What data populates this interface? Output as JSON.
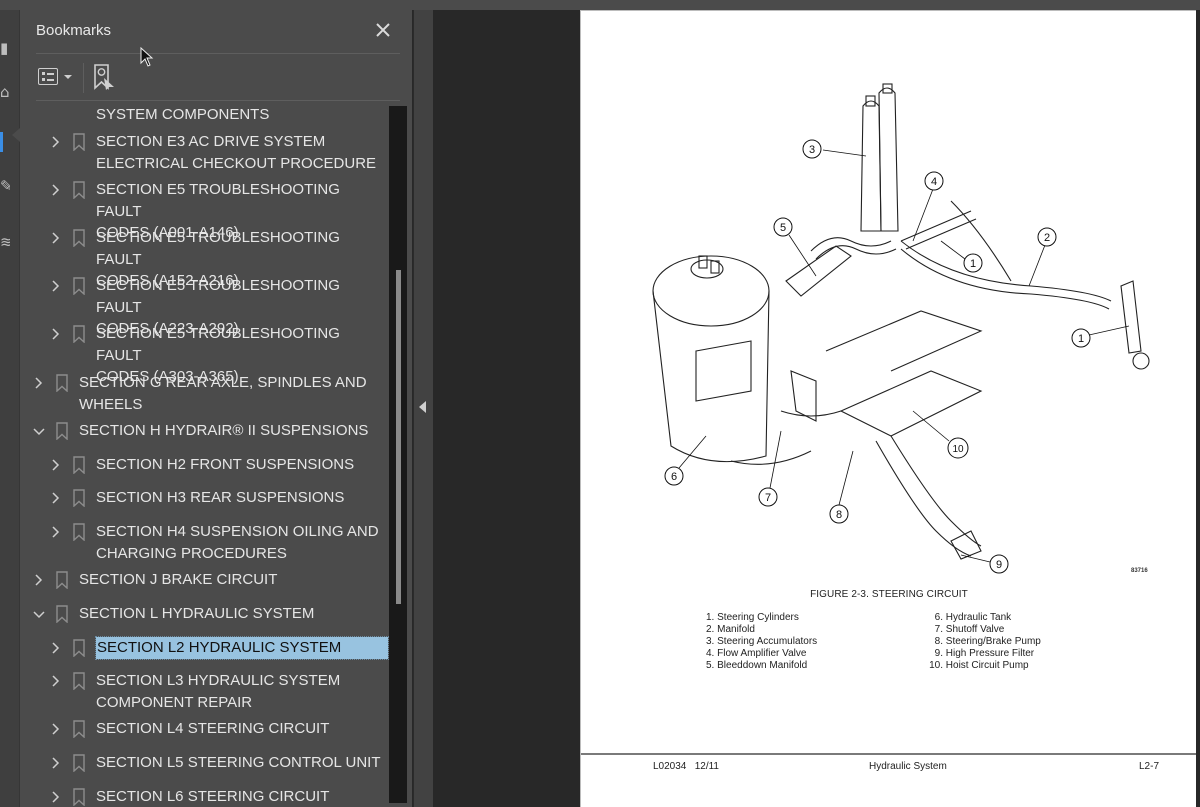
{
  "panel": {
    "title": "Bookmarks",
    "close_icon": "close-icon",
    "toolbar": {
      "options_icon": "list-options-icon",
      "new_bookmark_icon": "add-bookmark-icon"
    }
  },
  "bookmarks": [
    {
      "level": 2,
      "expanded": null,
      "partial": true,
      "label_lines": [
        "",
        "SYSTEM COMPONENTS"
      ]
    },
    {
      "level": 2,
      "expanded": false,
      "label_lines": [
        "SECTION E3 AC DRIVE SYSTEM",
        "ELECTRICAL CHECKOUT PROCEDURE"
      ]
    },
    {
      "level": 2,
      "expanded": false,
      "label_lines": [
        "SECTION E5 TROUBLESHOOTING FAULT",
        "CODES (A001-A146)"
      ]
    },
    {
      "level": 2,
      "expanded": false,
      "label_lines": [
        "SECTION E5 TROUBLESHOOTING FAULT",
        "CODES (A152-A216)"
      ]
    },
    {
      "level": 2,
      "expanded": false,
      "label_lines": [
        "SECTION E5 TROUBLESHOOTING FAULT",
        "CODES (A223-A292)"
      ]
    },
    {
      "level": 2,
      "expanded": false,
      "label_lines": [
        "SECTION E5 TROUBLESHOOTING FAULT",
        "CODES (A303-A365)"
      ]
    },
    {
      "level": 1,
      "expanded": false,
      "label_lines": [
        "SECTION G REAR AXLE, SPINDLES AND",
        "WHEELS"
      ]
    },
    {
      "level": 1,
      "expanded": true,
      "label_lines": [
        "SECTION H HYDRAIR® II SUSPENSIONS"
      ]
    },
    {
      "level": 2,
      "expanded": false,
      "label_lines": [
        "SECTION H2 FRONT SUSPENSIONS"
      ]
    },
    {
      "level": 2,
      "expanded": false,
      "label_lines": [
        "SECTION H3 REAR SUSPENSIONS"
      ]
    },
    {
      "level": 2,
      "expanded": false,
      "label_lines": [
        "SECTION H4 SUSPENSION OILING AND",
        "CHARGING PROCEDURES"
      ]
    },
    {
      "level": 1,
      "expanded": false,
      "label_lines": [
        "SECTION J BRAKE CIRCUIT"
      ]
    },
    {
      "level": 1,
      "expanded": true,
      "label_lines": [
        "SECTION L HYDRAULIC SYSTEM"
      ]
    },
    {
      "level": 2,
      "expanded": false,
      "selected": true,
      "label_lines": [
        "SECTION L2 HYDRAULIC SYSTEM"
      ]
    },
    {
      "level": 2,
      "expanded": false,
      "label_lines": [
        "SECTION L3 HYDRAULIC SYSTEM",
        "COMPONENT REPAIR"
      ]
    },
    {
      "level": 2,
      "expanded": false,
      "label_lines": [
        "SECTION L4 STEERING CIRCUIT"
      ]
    },
    {
      "level": 2,
      "expanded": false,
      "label_lines": [
        "SECTION L5 STEERING CONTROL UNIT"
      ]
    },
    {
      "level": 2,
      "expanded": false,
      "label_lines": [
        "SECTION L6 STEERING CIRCUIT"
      ]
    }
  ],
  "document": {
    "figure": {
      "caption": "FIGURE 2-3. STEERING CIRCUIT",
      "code": "83716",
      "callouts": [
        "1",
        "2",
        "3",
        "4",
        "5",
        "6",
        "7",
        "8",
        "9",
        "10",
        "1"
      ],
      "legend_col1": [
        {
          "num": "1.",
          "text": "Steering Cylinders"
        },
        {
          "num": "2.",
          "text": "Manifold"
        },
        {
          "num": "3.",
          "text": "Steering Accumulators"
        },
        {
          "num": "4.",
          "text": "Flow Amplifier Valve"
        },
        {
          "num": "5.",
          "text": "Bleeddown Manifold"
        }
      ],
      "legend_col2": [
        {
          "num": "6.",
          "text": "Hydraulic Tank"
        },
        {
          "num": "7.",
          "text": "Shutoff Valve"
        },
        {
          "num": "8.",
          "text": "Steering/Brake Pump"
        },
        {
          "num": "9.",
          "text": "High Pressure Filter"
        },
        {
          "num": "10.",
          "text": "Hoist Circuit Pump"
        }
      ]
    },
    "footer": {
      "left": "L02034   12/11",
      "center": "Hydraulic System",
      "right": "L2-7"
    }
  },
  "colors": {
    "panel_bg": "#4b4b4b",
    "viewer_bg": "#282828",
    "selection": "#98c3e0",
    "accent": "#3a8ee6"
  }
}
